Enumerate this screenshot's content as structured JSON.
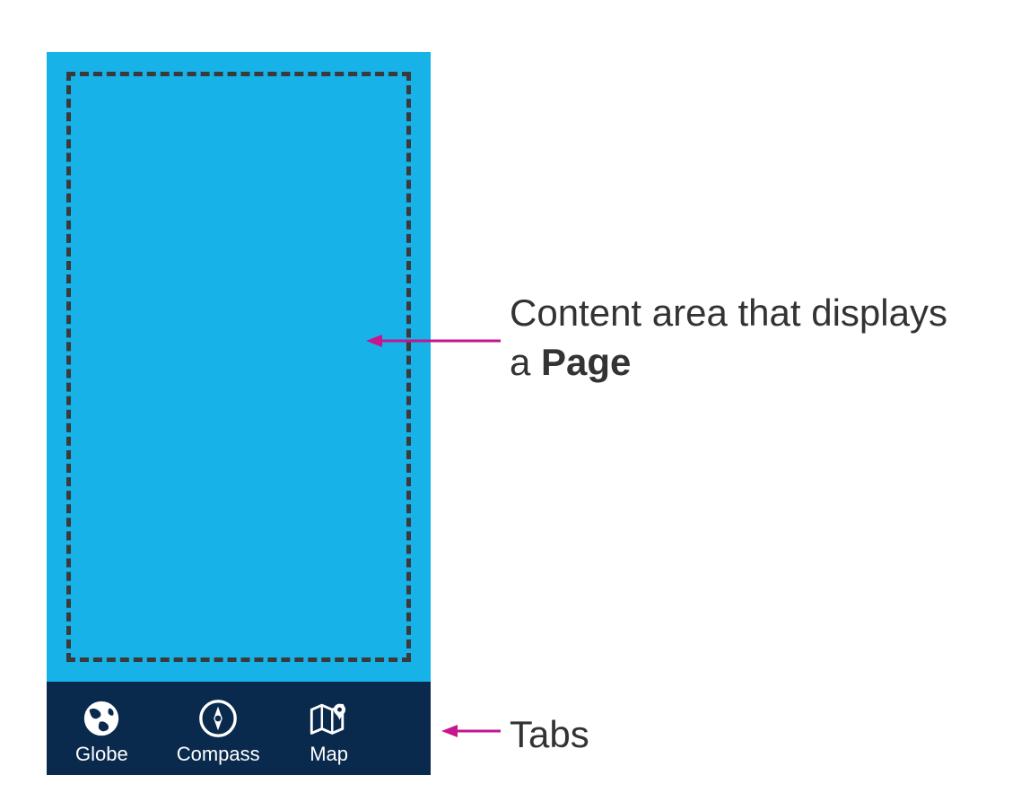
{
  "colors": {
    "content_bg": "#17b2e7",
    "tabbar_bg": "#0a2a4d",
    "dash_border": "#3a3a3a",
    "arrow": "#c6168d",
    "text": "#333333",
    "icon_fg": "#ffffff"
  },
  "annotations": {
    "content_html": "Content area that displays a <b>Page</b>",
    "tabs": "Tabs"
  },
  "tabs": [
    {
      "label": "Globe",
      "icon": "globe-icon"
    },
    {
      "label": "Compass",
      "icon": "compass-icon"
    },
    {
      "label": "Map",
      "icon": "map-icon"
    }
  ]
}
